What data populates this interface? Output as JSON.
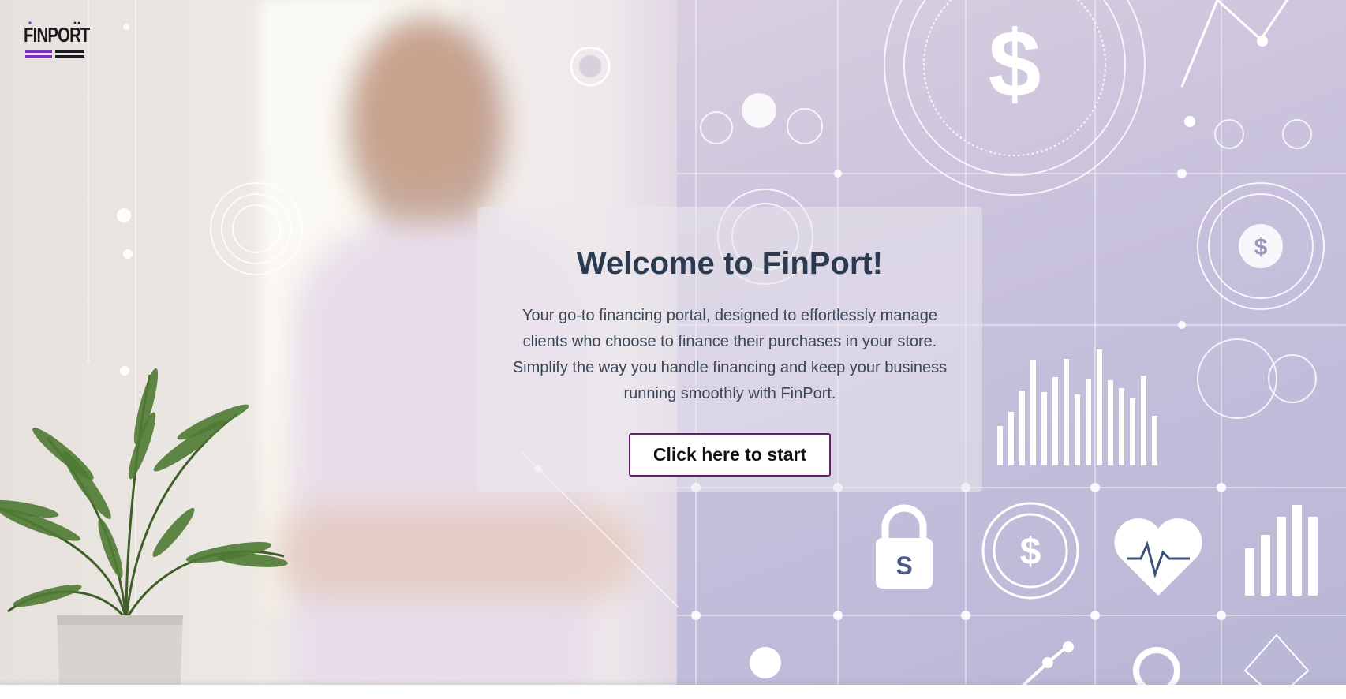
{
  "brand": {
    "logo_text": "FINPORT"
  },
  "hero": {
    "title": "Welcome to FinPort!",
    "description": "Your go-to financing portal, designed to effortlessly manage clients who choose to finance their purchases in your store. Simplify the way you handle financing and keep your business running smoothly with FinPort.",
    "cta_label": "Click here to start"
  },
  "colors": {
    "title": "#2b3a4f",
    "body_text": "#3a4658",
    "button_border": "#6a1b72",
    "logo_accent": "#7b2fbe",
    "logo_dark": "#1b1b1f"
  }
}
